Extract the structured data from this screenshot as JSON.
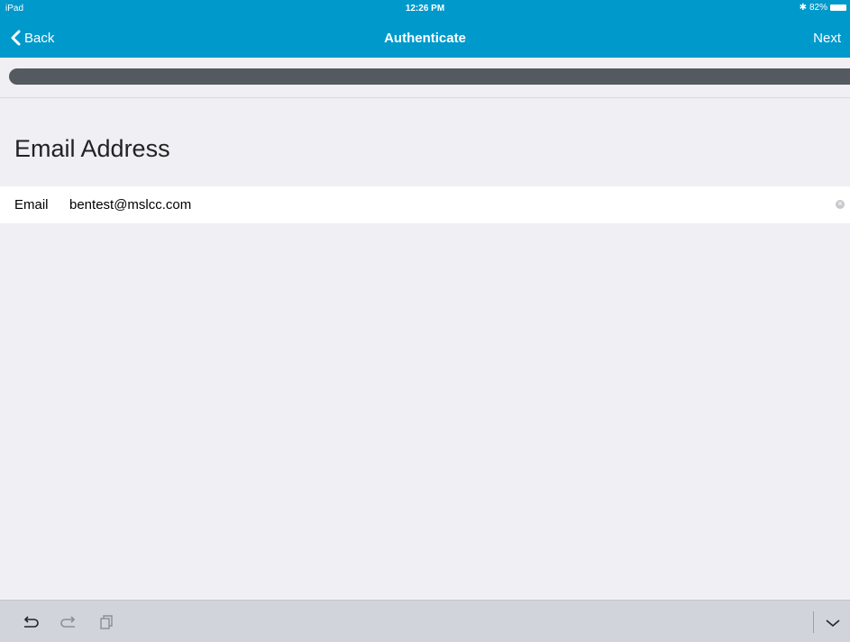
{
  "status": {
    "device": "iPad",
    "time": "12:26 PM",
    "battery": "82%"
  },
  "nav": {
    "back_label": "Back",
    "title": "Authenticate",
    "next_label": "Next"
  },
  "section": {
    "title": "Email Address"
  },
  "email": {
    "label": "Email",
    "value": "bentest@mslcc.com"
  },
  "keyboard": {
    "icons": [
      "undo-icon",
      "redo-icon",
      "paste-icon",
      "chevron-down-icon"
    ]
  },
  "colors": {
    "accent": "#0099cc",
    "progress": "#555960",
    "background": "#efeff4"
  }
}
